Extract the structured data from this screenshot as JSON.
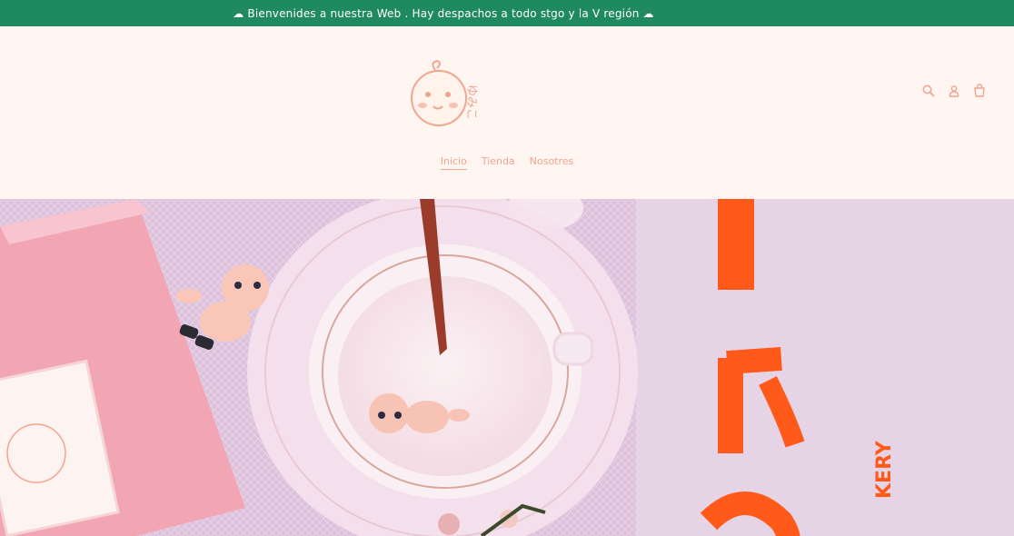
{
  "announcement": {
    "text": "☁ Bienvenides a nuestra Web . Hay despachos a todo stgo y la V región ☁"
  },
  "brand": {
    "logo_text": "ゆみこ",
    "accent": "#f0a58f",
    "bar_color": "#1f8a5f"
  },
  "nav": {
    "items": [
      "Inicio",
      "Tienda",
      "Nosotres"
    ],
    "active": "Inicio"
  },
  "header_icons": [
    "search-icon",
    "account-icon",
    "cart-icon"
  ],
  "hero": {
    "side_text": "KERY"
  }
}
